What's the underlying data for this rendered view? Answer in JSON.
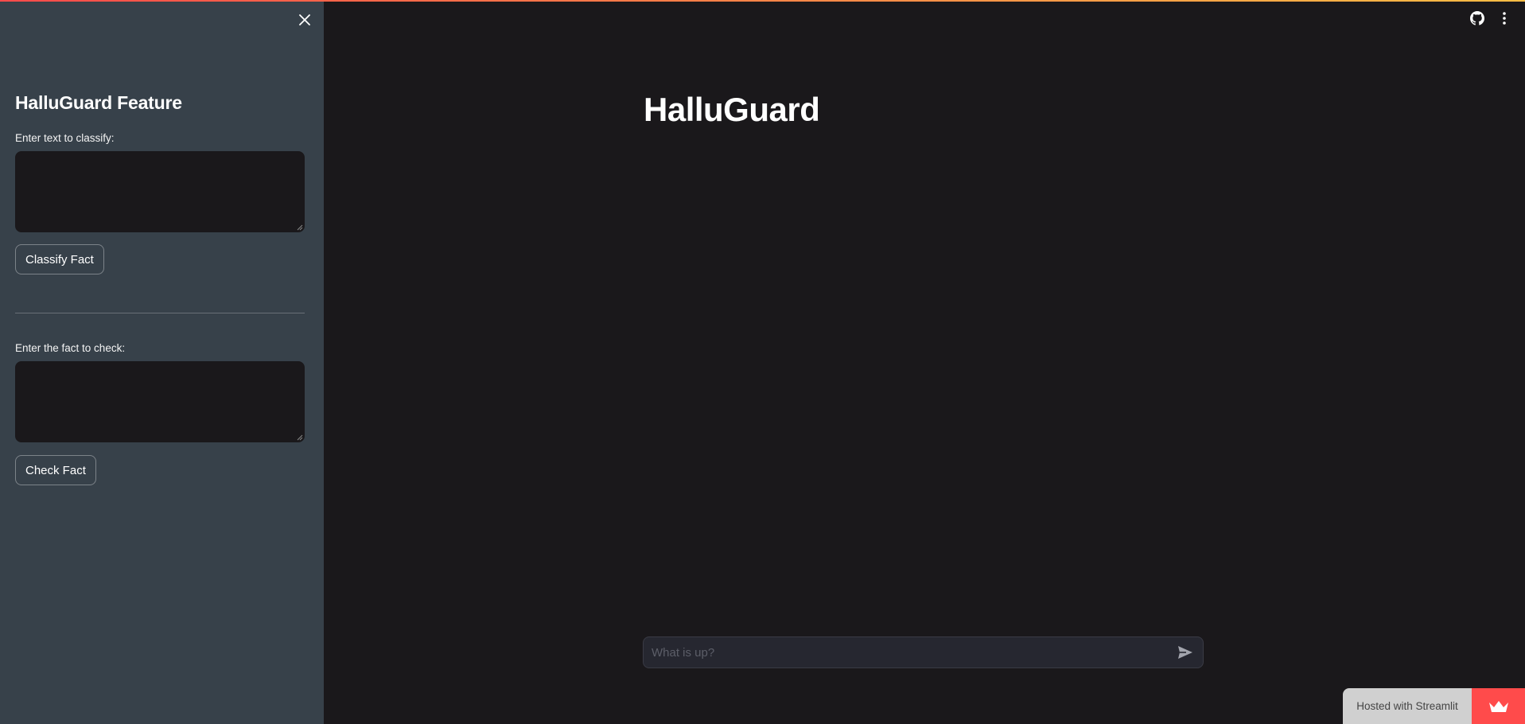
{
  "sidebar": {
    "title": "HalluGuard Feature",
    "classify": {
      "label": "Enter text to classify:",
      "value": "",
      "button_label": "Classify Fact"
    },
    "check": {
      "label": "Enter the fact to check:",
      "value": "",
      "button_label": "Check Fact"
    },
    "close_icon": "close-icon"
  },
  "header": {
    "icons": [
      "github-icon",
      "more-vertical-icon"
    ]
  },
  "main": {
    "title": "HalluGuard"
  },
  "chat": {
    "placeholder": "What is up?",
    "value": "",
    "send_icon": "send-icon"
  },
  "footer": {
    "hosted_label": "Hosted with Streamlit",
    "logo_icon": "streamlit-crown-icon"
  },
  "colors": {
    "sidebar_bg": "#37414a",
    "main_bg": "#1a181b",
    "accent": "#ff4b4b"
  }
}
